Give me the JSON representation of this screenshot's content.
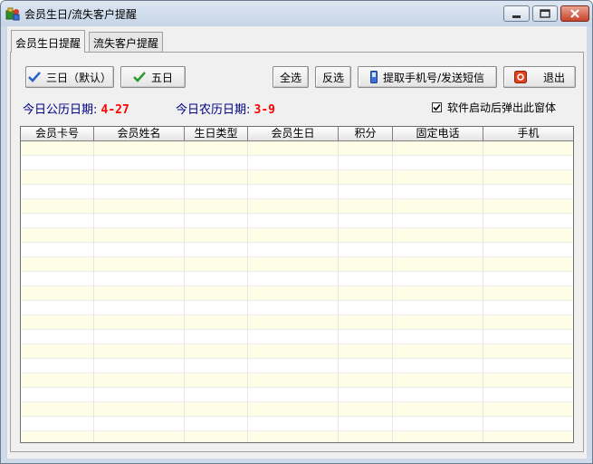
{
  "window": {
    "title": "会员生日/流失客户提醒",
    "icon": "app-icon"
  },
  "tabs": [
    {
      "label": "会员生日提醒",
      "active": true
    },
    {
      "label": "流失客户提醒",
      "active": false
    }
  ],
  "toolbar": {
    "three_days": "三日（默认）",
    "five_days": "五日",
    "select_all": "全选",
    "invert_selection": "反选",
    "extract_phone": "提取手机号/发送短信",
    "exit": "退出"
  },
  "dates": {
    "solar_label": "今日公历日期:",
    "solar_value": "4-27",
    "lunar_label": "今日农历日期:",
    "lunar_value": "3-9"
  },
  "popup_on_start": {
    "label": "软件启动后弹出此窗体",
    "checked": true
  },
  "grid": {
    "columns": [
      "会员卡号",
      "会员姓名",
      "生日类型",
      "会员生日",
      "积分",
      "固定电话",
      "手机"
    ],
    "rows": []
  },
  "colors": {
    "date_label": "#000080",
    "date_value": "#ff0000",
    "row_alt": "#fefee7"
  }
}
